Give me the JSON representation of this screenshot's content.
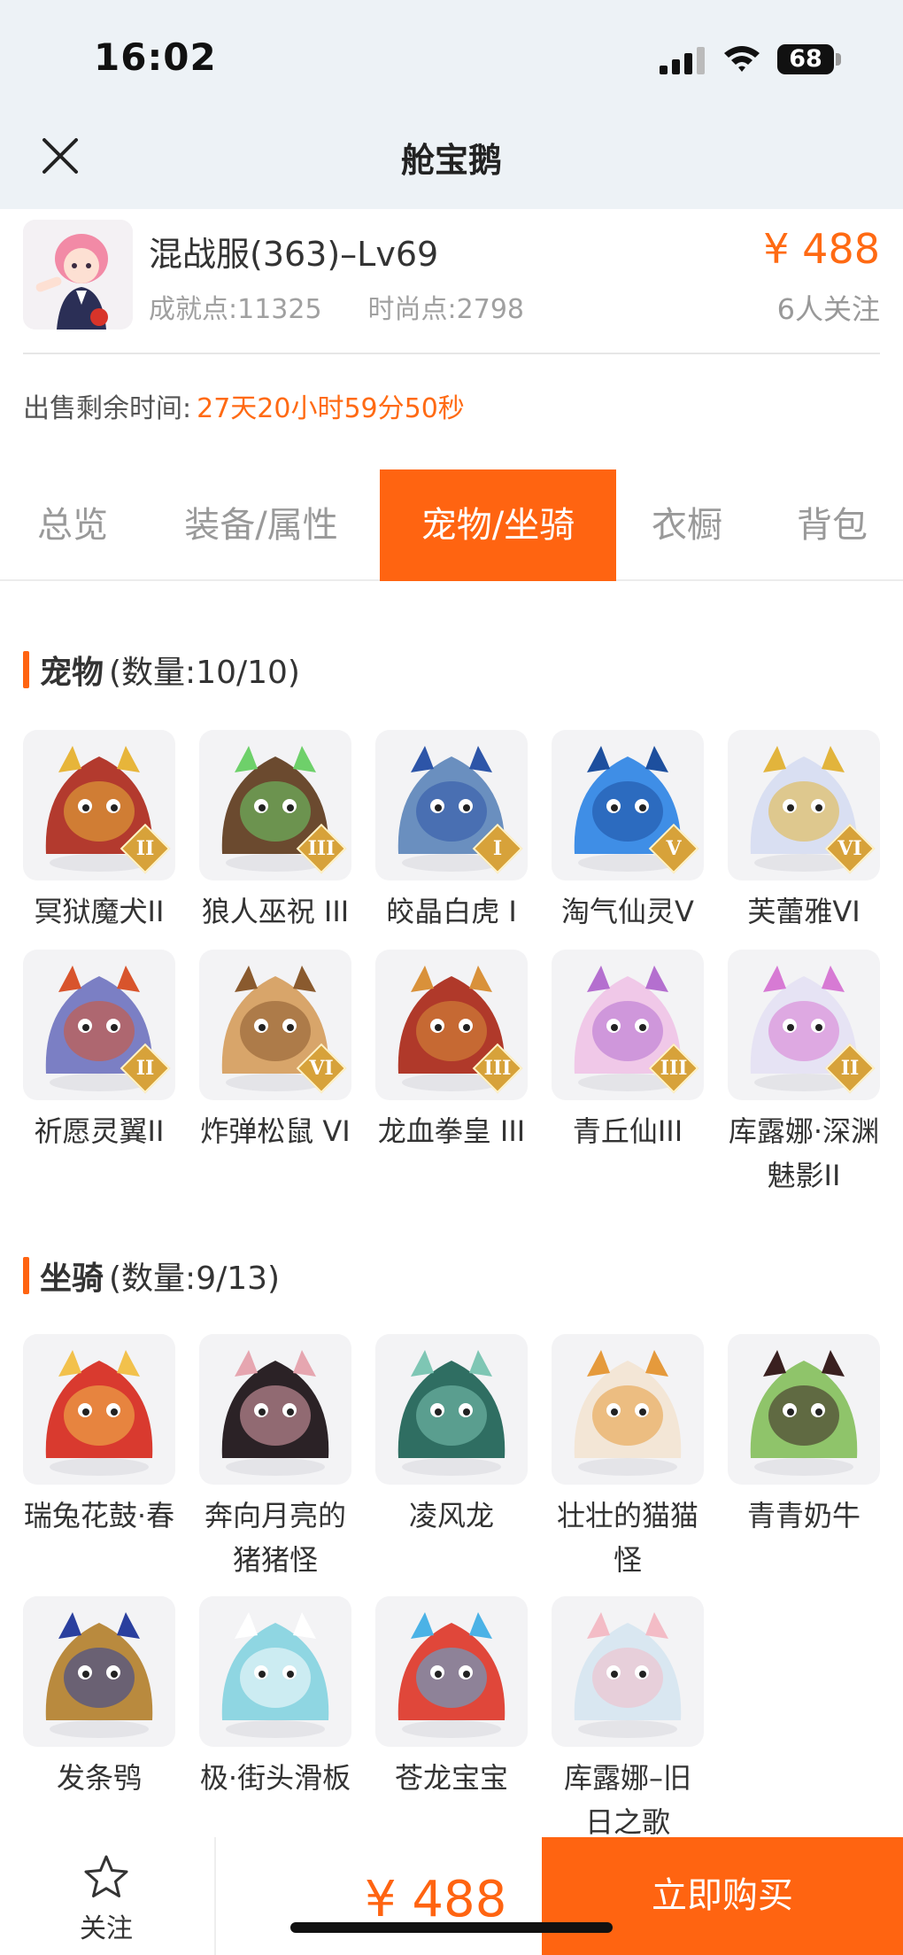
{
  "status_bar": {
    "time": "16:02",
    "battery": "68"
  },
  "nav": {
    "title": "舱宝鹅"
  },
  "account": {
    "server": "混战服(363)–Lv69",
    "achievement": "成就点:11325",
    "fashion": "时尚点:2798",
    "price": "¥ 488",
    "followers": "6人关注",
    "sale_label": "出售剩余时间:",
    "sale_value": "27天20小时59分50秒"
  },
  "tabs": [
    "总览",
    "装备/属性",
    "宠物/坐骑",
    "衣橱",
    "背包"
  ],
  "active_tab": "宠物/坐骑",
  "pets": {
    "title": "宠物",
    "count": "(数量:10/10)",
    "items": [
      {
        "name": "冥狱魔犬II",
        "rank": "II",
        "color": "#b33a2e",
        "accent": "#e7b53a"
      },
      {
        "name": "狼人巫祝 III",
        "rank": "III",
        "color": "#6b4a2f",
        "accent": "#6ed06a"
      },
      {
        "name": "皎晶白虎 I",
        "rank": "I",
        "color": "#6a8fbf",
        "accent": "#2d55a8"
      },
      {
        "name": "淘气仙灵V",
        "rank": "V",
        "color": "#3f8ee6",
        "accent": "#1d4f9e"
      },
      {
        "name": "芙蕾雅VI",
        "rank": "VI",
        "color": "#d9dff2",
        "accent": "#e2b43c"
      },
      {
        "name": "祈愿灵翼II",
        "rank": "II",
        "color": "#7b7fc4",
        "accent": "#d8542c"
      },
      {
        "name": "炸弹松鼠 VI",
        "rank": "VI",
        "color": "#d8a56a",
        "accent": "#8a5a2e"
      },
      {
        "name": "龙血拳皇 III",
        "rank": "III",
        "color": "#b0392a",
        "accent": "#d9913a"
      },
      {
        "name": "青丘仙III",
        "rank": "III",
        "color": "#f0c8e8",
        "accent": "#b46fcf"
      },
      {
        "name": "库露娜·深渊魅影II",
        "rank": "II",
        "color": "#e6e3f4",
        "accent": "#d77ad4"
      }
    ]
  },
  "mounts": {
    "title": "坐骑",
    "count": "(数量:9/13)",
    "items": [
      {
        "name": "瑞兔花鼓·春",
        "color": "#d93a2f",
        "accent": "#f2c14c"
      },
      {
        "name": "奔向月亮的猪猪怪",
        "color": "#2b2226",
        "accent": "#e6a6b0"
      },
      {
        "name": "凌风龙",
        "color": "#2f6e62",
        "accent": "#7ec6b4"
      },
      {
        "name": "壮壮的猫猫怪",
        "color": "#f3e6d6",
        "accent": "#e59a3c"
      },
      {
        "name": "青青奶牛",
        "color": "#8fc46a",
        "accent": "#3a2020"
      },
      {
        "name": "发条鸮",
        "color": "#b98a3e",
        "accent": "#2a3f9e"
      },
      {
        "name": "极·街头滑板",
        "color": "#8fd6e2",
        "accent": "#ffffff"
      },
      {
        "name": "苍龙宝宝",
        "color": "#e0473a",
        "accent": "#4bb2e6"
      },
      {
        "name": "库露娜–旧日之歌",
        "color": "#d9e7f1",
        "accent": "#f3bcc6"
      }
    ]
  },
  "bottom": {
    "follow": "关注",
    "price": "¥ 488",
    "buy": "立即购买"
  }
}
